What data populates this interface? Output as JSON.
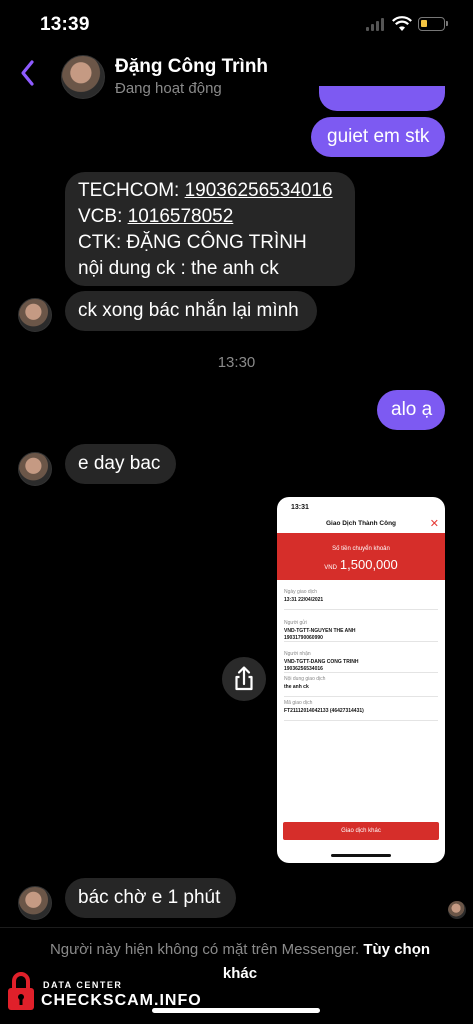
{
  "status_bar": {
    "time": "13:39"
  },
  "header": {
    "name": "Đặng Công Trình",
    "status": "Đang hoạt động"
  },
  "messages": {
    "m1": "guiet em stk",
    "m2": {
      "l1_prefix": "TECHCOM: ",
      "l1_num": "19036256534016",
      "l2_prefix": "VCB: ",
      "l2_num": "1016578052",
      "l3": "CTK: ĐẶNG CÔNG TRÌNH",
      "l4": "nội dung ck : the anh ck"
    },
    "m3": "ck xong bác nhắn lại mình",
    "timestamp": "13:30",
    "m4": "alo ạ",
    "m5": "e day bac",
    "m6": "bác chờ e 1 phút"
  },
  "shared_image": {
    "time": "13:31",
    "title": "Giao Dịch Thành Công",
    "amount_label": "Số tiền chuyển khoản",
    "currency": "VND",
    "amount": "1,500,000",
    "rows": [
      {
        "k": "Ngày giao dịch",
        "v": "13:31 22/04/2021"
      },
      {
        "k": "Người gửi",
        "v": "VND-TGTT-NGUYEN THE ANH\n19031790060990"
      },
      {
        "k": "Người nhận",
        "v": "VND-TGTT-DANG CONG TRINH\n19036256534016"
      },
      {
        "k": "Nội dung giao dịch",
        "v": "the anh ck"
      },
      {
        "k": "Mã giao dịch",
        "v": "FT21112014042133 (46427314431)"
      }
    ],
    "button": "Giao dịch khác"
  },
  "footer": {
    "text": "Người này hiện không có mặt trên Messenger.",
    "link": "Tùy chọn khác"
  },
  "watermark": {
    "top": "DATA CENTER",
    "main": "CHECKSCAM.INFO"
  },
  "colors": {
    "accent": "#7d5af2",
    "incoming": "#262626",
    "bank_red": "#d62e2a"
  }
}
